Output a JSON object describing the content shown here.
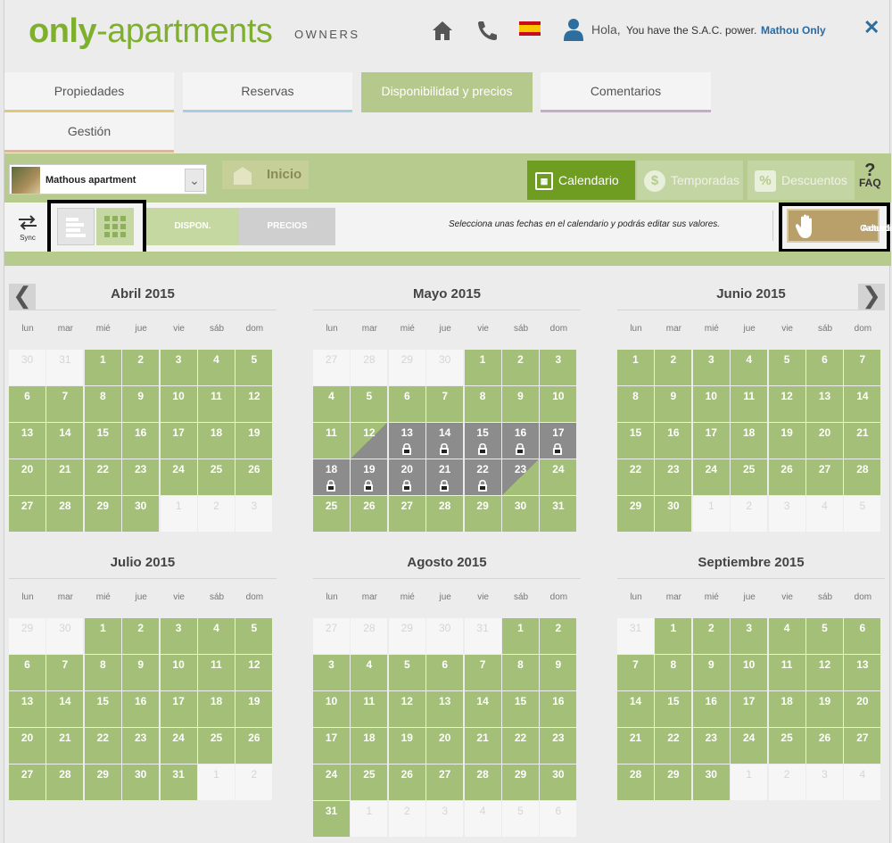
{
  "header": {
    "logo_part1": "only",
    "logo_part2": "-apartments",
    "logo_sub": "OWNERS",
    "greeting": "Hola,",
    "sac_text": "You have the S.A.C. power.",
    "user_name": "Mathou Only",
    "close": "✕",
    "icons": [
      "home-icon",
      "phone-icon",
      "spain-flag-icon",
      "user-icon"
    ]
  },
  "tabs": [
    {
      "label": "Propiedades",
      "active": false,
      "color": "#e0c77c"
    },
    {
      "label": "Reservas",
      "active": false,
      "color": "#a9cde0"
    },
    {
      "label": "Disponibilidad y precios",
      "active": true,
      "color": "#b5c98c"
    },
    {
      "label": "Comentarios",
      "active": false,
      "color": "#c9a9c9"
    },
    {
      "label": "Gestión",
      "active": false,
      "color": "#d8b89e"
    }
  ],
  "property_select": {
    "value": "Mathous apartment"
  },
  "inicio_label": "Inicio",
  "nav_buttons": [
    {
      "label": "Calendario",
      "active": true,
      "icon": "calendar-icon"
    },
    {
      "label": "Temporadas",
      "active": false,
      "icon": "dollar-icon"
    },
    {
      "label": "Descuentos",
      "active": false,
      "icon": "tag-icon"
    }
  ],
  "faq_label": "FAQ",
  "toolbar": {
    "sync_label": "Sync",
    "dispon_label": "DISPON.",
    "precios_label": "PRECIOS",
    "hint": "Selecciona unas fechas en el calendario y podrás editar sus valores.",
    "actualizar_line1": "Actualizar",
    "actualizar_line2": "Calendario"
  },
  "weekdays": [
    "lun",
    "mar",
    "mié",
    "jue",
    "vie",
    "sáb",
    "dom"
  ],
  "nav_arrows": {
    "prev": "❮",
    "next": "❯"
  },
  "months": [
    {
      "title": "Abril 2015",
      "lead": [
        30,
        31
      ],
      "days": 30,
      "trail": [
        1,
        2,
        3
      ]
    },
    {
      "title": "Mayo 2015",
      "lead": [
        27,
        28,
        29,
        30
      ],
      "days": 31,
      "trail": [],
      "blocked": [
        13,
        14,
        15,
        16,
        17,
        18,
        19,
        20,
        21,
        22
      ],
      "locked": [
        13,
        14,
        15,
        16,
        17,
        18,
        19,
        20,
        21,
        22
      ],
      "half_start": 12,
      "half_end": 23
    },
    {
      "title": "Junio 2015",
      "lead": [],
      "days": 30,
      "trail": [
        1,
        2,
        3,
        4,
        5
      ]
    },
    {
      "title": "Julio 2015",
      "lead": [
        29,
        30
      ],
      "days": 31,
      "trail": [
        1,
        2
      ]
    },
    {
      "title": "Agosto 2015",
      "lead": [
        27,
        28,
        29,
        30,
        31
      ],
      "days": 31,
      "trail": [
        1,
        2,
        3,
        4,
        5,
        6
      ]
    },
    {
      "title": "Septiembre 2015",
      "lead": [
        31
      ],
      "days": 30,
      "trail": [
        1,
        2,
        3,
        4
      ]
    }
  ],
  "colors": {
    "available": "#a3bf78",
    "blocked": "#8c8c8c",
    "accent": "#7fb02d",
    "active_nav": "#6f9d22"
  }
}
